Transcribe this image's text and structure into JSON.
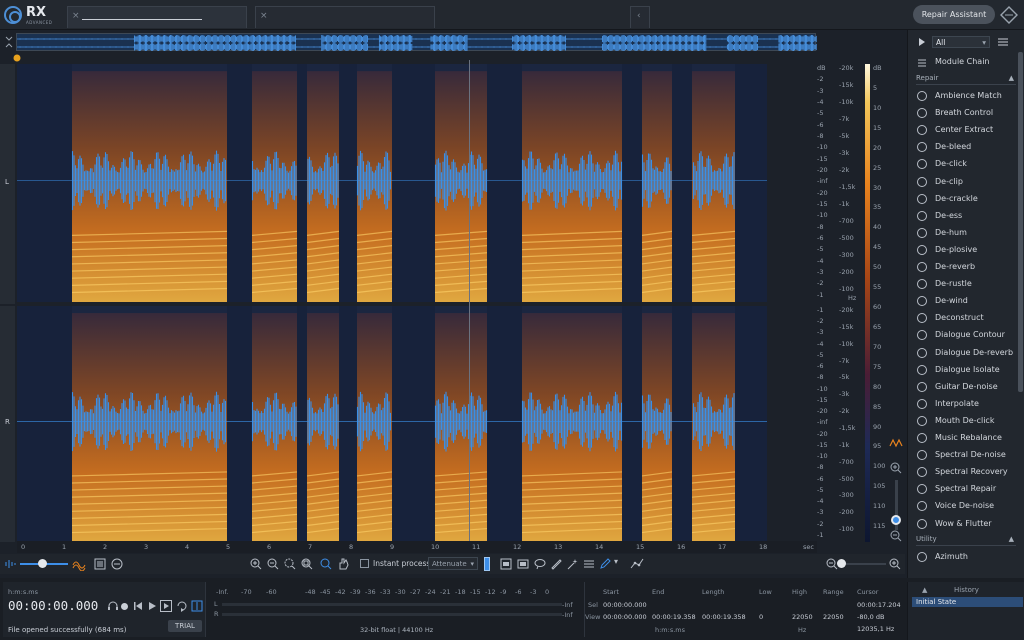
{
  "app": {
    "logo_text": "RX",
    "logo_sub": "ADVANCED",
    "repair_assistant": "Repair Assistant"
  },
  "top_tabs": [
    {
      "close": "×"
    },
    {
      "close": "×"
    },
    {
      "close": "‹"
    }
  ],
  "channels": {
    "left": "L",
    "right": "R"
  },
  "freq_scale_top": [
    "-20k",
    "-15k",
    "-10k",
    "-7k",
    "-5k",
    "-3k",
    "-2k",
    "-1,5k",
    "-1k",
    "-700",
    "-500",
    "-300",
    "-200",
    "-100"
  ],
  "freq_scale_bottom": [
    "-20k",
    "-15k",
    "-10k",
    "-7k",
    "-5k",
    "-3k",
    "-2k",
    "-1,5k",
    "-1k",
    "-700",
    "-500",
    "-300",
    "-200",
    "-100"
  ],
  "db_wave_top": [
    "dB",
    "-2",
    "-3",
    "-4",
    "-5",
    "-6",
    "-8",
    "-10",
    "-15",
    "-20",
    "-inf",
    "-20",
    "-15",
    "-10",
    "-8",
    "-6",
    "-5",
    "-4",
    "-3",
    "-2",
    "-1"
  ],
  "db_wave_bottom": [
    "-1",
    "-2",
    "-3",
    "-4",
    "-5",
    "-6",
    "-8",
    "-10",
    "-15",
    "-20",
    "-inf",
    "-20",
    "-15",
    "-10",
    "-8",
    "-6",
    "-5",
    "-4",
    "-3",
    "-2",
    "-1"
  ],
  "db_color_scale": [
    "dB",
    "5",
    "10",
    "15",
    "20",
    "25",
    "30",
    "35",
    "40",
    "45",
    "50",
    "55",
    "60",
    "65",
    "70",
    "75",
    "80",
    "85",
    "90",
    "95",
    "100",
    "105",
    "110",
    "115"
  ],
  "hz_label": "Hz",
  "time_ruler": [
    "0",
    "1",
    "2",
    "3",
    "4",
    "5",
    "6",
    "7",
    "8",
    "9",
    "10",
    "11",
    "12",
    "13",
    "14",
    "15",
    "16",
    "17",
    "18"
  ],
  "time_unit": "sec",
  "toolbar": {
    "instant_process": "Instant process",
    "attenuate": "Attenuate"
  },
  "transport": {
    "time_format": "h:m:s.ms",
    "time": "00:00:00.000",
    "status": "File opened successfully (684 ms)",
    "trial": "TRIAL"
  },
  "meter": {
    "scale": [
      "-Inf.",
      "-70",
      "-60",
      "-48",
      "-45",
      "-42",
      "-39",
      "-36",
      "-33",
      "-30",
      "-27",
      "-24",
      "-21",
      "-18",
      "-15",
      "-12",
      "-9",
      "-6",
      "-3",
      "0"
    ],
    "l": "L",
    "r": "R",
    "inf_l": "-Inf",
    "inf_r": "-Inf",
    "format": "32-bit float | 44100 Hz"
  },
  "selection": {
    "headers": [
      "Start",
      "End",
      "Length",
      "Low",
      "High",
      "Range",
      "Cursor"
    ],
    "sel_label": "Sel",
    "view_label": "View",
    "sel_start": "00:00:00.000",
    "view_start": "00:00:00.000",
    "view_end": "00:00:19.358",
    "view_length": "00:00:19.358",
    "low": "0",
    "high": "22050",
    "range": "22050",
    "cursor_time": "00:00:17.204",
    "cursor_db": "-80,0 dB",
    "cursor_hz": "12035,1 Hz",
    "unit_time": "h:m:s.ms",
    "unit_hz": "Hz"
  },
  "right_panel": {
    "filter": "All",
    "module_chain": "Module Chain",
    "repair_header": "Repair",
    "modules": [
      "Ambience Match",
      "Breath Control",
      "Center Extract",
      "De-bleed",
      "De-click",
      "De-clip",
      "De-crackle",
      "De-ess",
      "De-hum",
      "De-plosive",
      "De-reverb",
      "De-rustle",
      "De-wind",
      "Deconstruct",
      "Dialogue Contour",
      "Dialogue De-reverb",
      "Dialogue Isolate",
      "Guitar De-noise",
      "Interpolate",
      "Mouth De-click",
      "Music Rebalance",
      "Spectral De-noise",
      "Spectral Recovery",
      "Spectral Repair",
      "Voice De-noise",
      "Wow & Flutter"
    ],
    "utility_header": "Utility",
    "utility": [
      "Azimuth"
    ],
    "history_header": "History",
    "history_item": "Initial State"
  },
  "colors": {
    "accent": "#3d8ee8",
    "wave": "#3a8fe6",
    "spectro_hot": "#e8831e",
    "bg": "#1c2129"
  }
}
